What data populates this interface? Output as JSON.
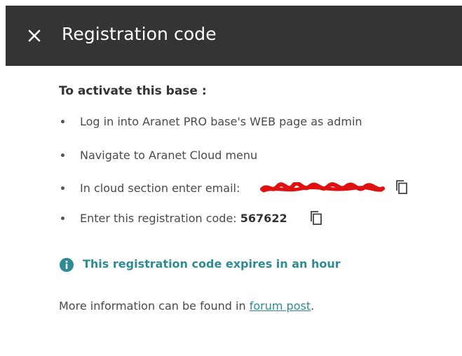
{
  "dialog": {
    "title": "Registration code",
    "close_icon": "close-icon"
  },
  "content": {
    "heading": "To activate this base :",
    "steps": [
      {
        "text": "Log in into Aranet PRO base's WEB page as admin"
      },
      {
        "text": "Navigate to Aranet Cloud menu"
      },
      {
        "text": "In cloud section enter email:"
      },
      {
        "text": "Enter this registration code:",
        "code": "567622"
      }
    ],
    "info_icon": "info-icon",
    "info_text": "This registration code expires in an hour",
    "more_info_prefix": "More information can be found in ",
    "more_info_link": "forum post",
    "more_info_suffix": "."
  },
  "colors": {
    "header_bg": "#343434",
    "accent": "#2e8b93",
    "redaction": "#e01010"
  }
}
